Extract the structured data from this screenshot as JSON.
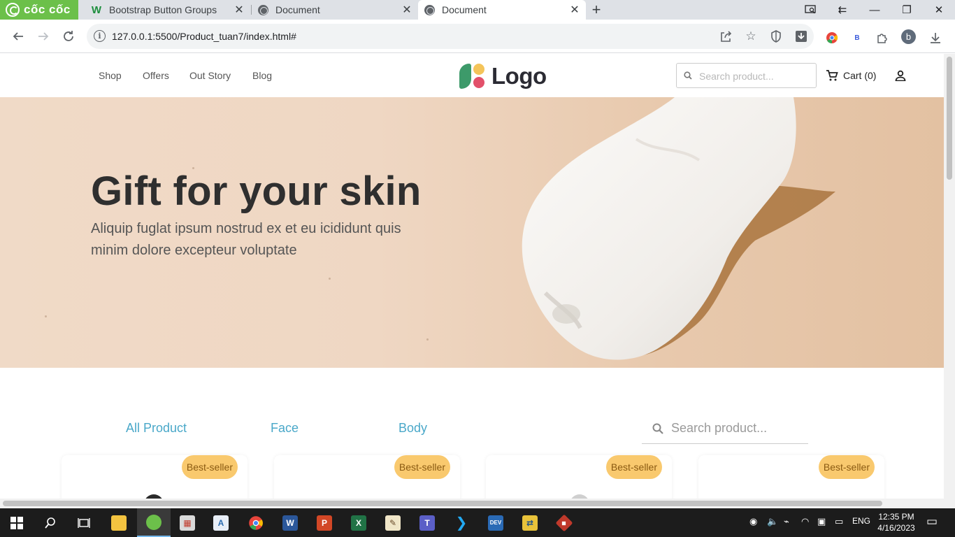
{
  "browser": {
    "brand": "cốc cốc",
    "tabs": [
      {
        "title": "Bootstrap Button Groups",
        "favicon": "w3schools-icon"
      },
      {
        "title": "Document",
        "favicon": "globe-icon"
      },
      {
        "title": "Document",
        "favicon": "globe-icon",
        "active": true
      }
    ],
    "url": "127.0.0.1:5500/Product_tuan7/index.html#",
    "profile_initial": "b",
    "ext_b_label": "B"
  },
  "site": {
    "nav": [
      "Shop",
      "Offers",
      "Out Story",
      "Blog"
    ],
    "logo_text": "Logo",
    "search_placeholder": "Search product...",
    "cart_label": "Cart (0)",
    "colors": {
      "accent": "#4aa8c9",
      "badge": "#f9c96e",
      "logo_green": "#3d9a6a",
      "logo_yellow": "#f4c45a",
      "logo_pink": "#e2506a"
    }
  },
  "hero": {
    "title": "Gift for your skin",
    "subtitle": "Aliquip fuglat ipsum nostrud ex et eu icididunt quis minim dolore excepteur voluptate"
  },
  "filters": {
    "tabs": [
      "All Product",
      "Face",
      "Body"
    ],
    "search_placeholder": "Search product..."
  },
  "products": [
    {
      "badge": "Best-seller"
    },
    {
      "badge": "Best-seller"
    },
    {
      "badge": "Best-seller"
    },
    {
      "badge": "Best-seller"
    }
  ],
  "taskbar": {
    "language": "ENG",
    "time": "12:35 PM",
    "date": "4/16/2023",
    "apps": [
      "start-icon",
      "search-icon",
      "task-view-icon",
      "file-explorer-icon",
      "coccoc-icon",
      "calendar-app-icon",
      "paint-app-icon",
      "chrome-icon",
      "word-icon",
      "powerpoint-icon",
      "excel-icon",
      "paint-brush-icon",
      "teams-icon",
      "vscode-icon",
      "devc-icon",
      "app-icon",
      "git-icon"
    ]
  }
}
